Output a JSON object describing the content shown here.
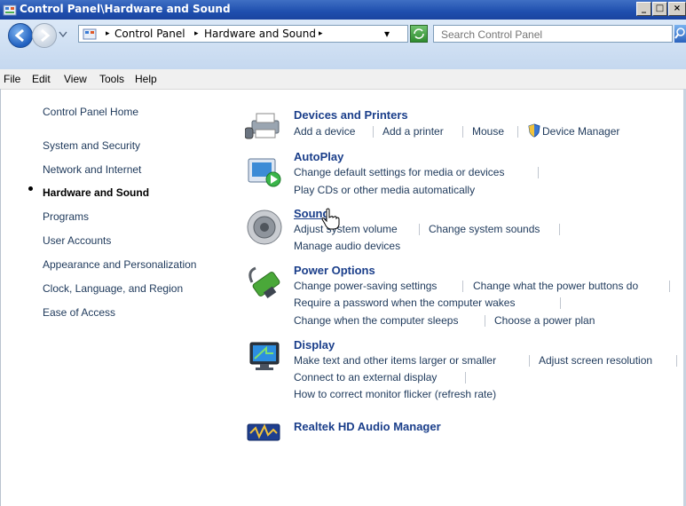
{
  "window": {
    "title": "Control Panel\\Hardware and Sound",
    "min": "_",
    "max": "□",
    "close": "×"
  },
  "address": {
    "crumbs": [
      "Control Panel",
      "Hardware and Sound"
    ],
    "sep": "▸",
    "dropdown": "▾"
  },
  "search": {
    "placeholder": "Search Control Panel"
  },
  "menu": [
    "File",
    "Edit",
    "View",
    "Tools",
    "Help"
  ],
  "sidebar": {
    "home": "Control Panel Home",
    "items": [
      "System and Security",
      "Network and Internet",
      "Hardware and Sound",
      "Programs",
      "User Accounts",
      "Appearance and Personalization",
      "Clock, Language, and Region",
      "Ease of Access"
    ],
    "current_index": 2
  },
  "categories": {
    "devices": {
      "title": "Devices and Printers",
      "links": [
        "Add a device",
        "Add a printer",
        "Mouse",
        "Device Manager"
      ],
      "icon": "printer-icon"
    },
    "autoplay": {
      "title": "AutoPlay",
      "links": [
        "Change default settings for media or devices",
        "Play CDs or other media automatically"
      ],
      "icon": "autoplay-icon"
    },
    "sound": {
      "title": "Sound",
      "links": [
        "Adjust system volume",
        "Change system sounds",
        "Manage audio devices"
      ],
      "icon": "speaker-icon"
    },
    "power": {
      "title": "Power Options",
      "links": [
        "Change power-saving settings",
        "Change what the power buttons do",
        "Require a password when the computer wakes",
        "Change when the computer sleeps",
        "Choose a power plan"
      ],
      "icon": "battery-icon"
    },
    "display": {
      "title": "Display",
      "links": [
        "Make text and other items larger or smaller",
        "Adjust screen resolution",
        "Connect to an external display",
        "How to correct monitor flicker (refresh rate)"
      ],
      "icon": "monitor-icon"
    },
    "realtek": {
      "title": "Realtek HD Audio Manager",
      "icon": "audio-manager-icon"
    }
  }
}
